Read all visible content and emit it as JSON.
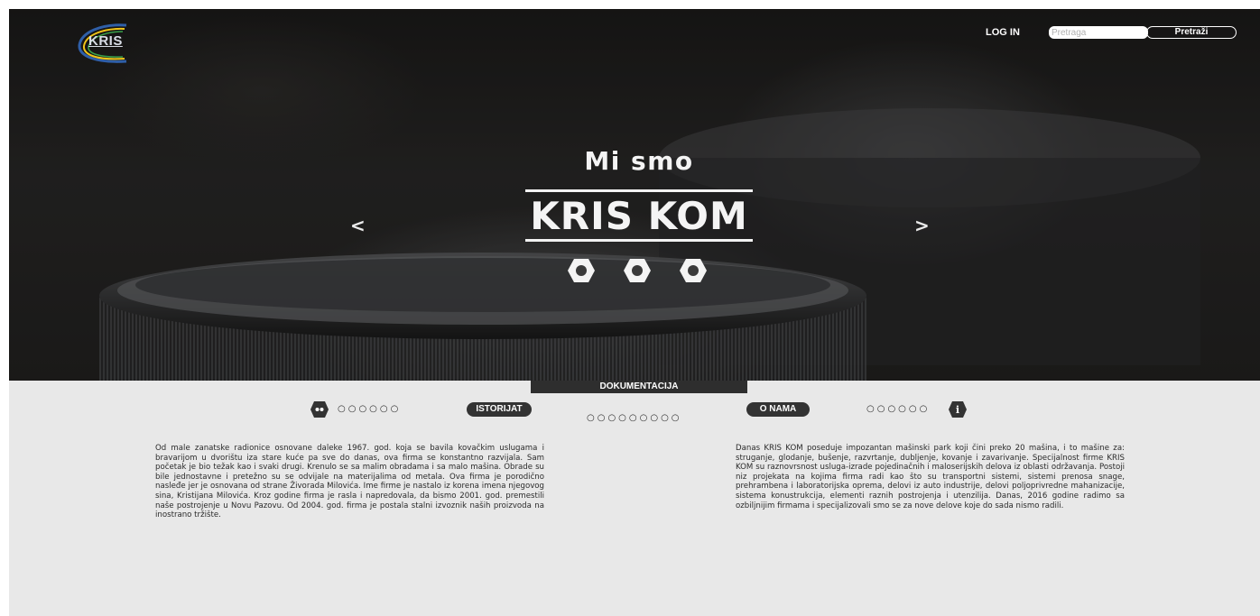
{
  "header": {
    "logo_text": "KRIS",
    "login_label": "LOG IN",
    "search_placeholder": "Pretraga",
    "search_button": "Pretraži"
  },
  "hero": {
    "subtitle": "Mi smo",
    "title": "KRIS KOM",
    "prev_arrow": "<",
    "next_arrow": ">",
    "slide_count": 3
  },
  "content": {
    "doc_tab": "DOKUMENTACIJA",
    "left_pill": "ISTORIJAT",
    "right_pill": "O NAMA",
    "left_dots": "○○○○○○",
    "middle_dots": "○○○○○○○○○",
    "right_dots": "○○○○○○",
    "left_text": "Od male zanatske radionice osnovane daleke 1967. god. koja se bavila kovačkim uslugama i bravarijom u dvorištu iza stare kuće pa sve do danas, ova firma se konstantno razvijala. Sam početak je bio težak kao i svaki drugi. Krenulo se sa malim obradama i sa malo mašina. Obrade su bile jednostavne i pretežno su se odvijale na materijalima od metala. Ova firma je porodično nasleđe jer je osnovana od strane Živorada Milovića. Ime firme je nastalo iz korena imena njegovog sina, Kristijana Milovića. Kroz godine firma je rasla i napredovala, da bismo 2001. god. premestili naše postrojenje u Novu Pazovu. Od 2004. god. firma je postala stalni izvoznik naših proizvoda na inostrano tržište.",
    "right_text": "Danas KRIS KOM poseduje impozantan mašinski park koji čini preko 20 mašina, i to mašine za: struganje, glodanje, bušenje, razvrtanje, dubljenje, kovanje i zavarivanje. Specijalnost firme KRIS KOM su raznovrsnost usluga-izrade pojedinačnih i maloserijskih delova iz oblasti održavanja. Postoji niz projekata na kojima firma radi kao što su transportni sistemi, sistemi prenosa snage, prehrambena i laboratorijska oprema, delovi iz auto industrije, delovi poljoprivredne mahanizacije, sistema konustrukcija, elementi raznih postrojenja i utenzilija. Danas, 2016 godine radimo sa ozbiljnijim firmama i specijalizovali smo se za nove delove koje do sada nismo radili."
  },
  "colors": {
    "content_bg": "#e8e8e8",
    "dark": "#333333",
    "hero_text": "#f4f4f4"
  },
  "icons": [
    "logo-swoosh-icon",
    "hex-nut-icon",
    "history-icon",
    "info-icon"
  ]
}
